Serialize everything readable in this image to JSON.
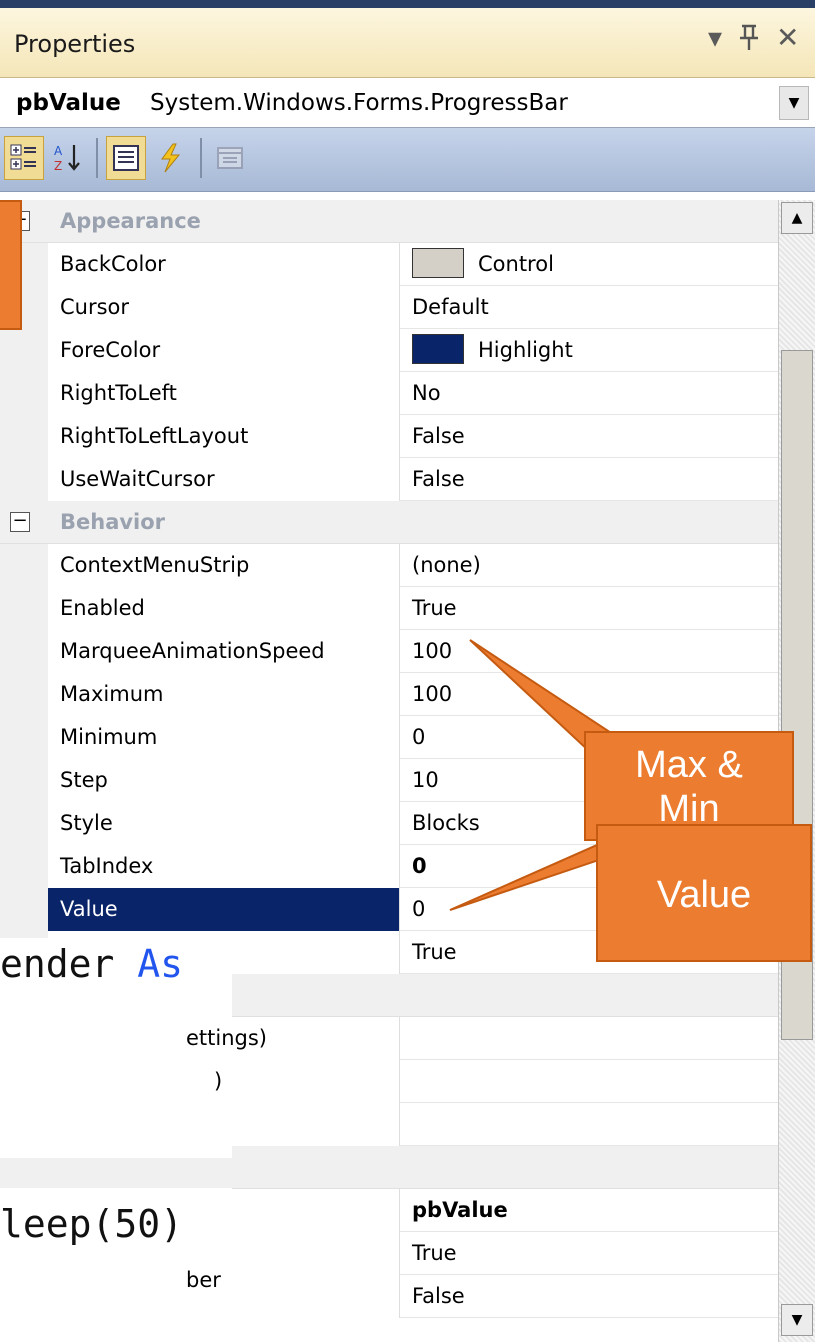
{
  "window": {
    "title": "Properties",
    "controls": {
      "dropdown": "▾",
      "pin": "📌",
      "close": "✕"
    }
  },
  "object_selector": {
    "name": "pbValue",
    "type": "System.Windows.Forms.ProgressBar"
  },
  "toolbar": {
    "buttons": [
      "categorized-icon",
      "alphabetical-icon",
      "properties-icon",
      "events-icon",
      "property-pages-icon"
    ]
  },
  "categories": [
    {
      "label": "Appearance",
      "rows": [
        {
          "name": "BackColor",
          "value": "Control",
          "swatch": "#d4d0c8"
        },
        {
          "name": "Cursor",
          "value": "Default"
        },
        {
          "name": "ForeColor",
          "value": "Highlight",
          "swatch": "#0a246a"
        },
        {
          "name": "RightToLeft",
          "value": "No"
        },
        {
          "name": "RightToLeftLayout",
          "value": "False"
        },
        {
          "name": "UseWaitCursor",
          "value": "False"
        }
      ]
    },
    {
      "label": "Behavior",
      "rows": [
        {
          "name": "ContextMenuStrip",
          "value": "(none)"
        },
        {
          "name": "Enabled",
          "value": "True"
        },
        {
          "name": "MarqueeAnimationSpeed",
          "value": "100"
        },
        {
          "name": "Maximum",
          "value": "100"
        },
        {
          "name": "Minimum",
          "value": "0"
        },
        {
          "name": "Step",
          "value": "10"
        },
        {
          "name": "Style",
          "value": "Blocks"
        },
        {
          "name": "TabIndex",
          "value": "0",
          "bold": true
        },
        {
          "name": "Value",
          "value": "0",
          "selected": true
        },
        {
          "name": "",
          "value": "True"
        }
      ]
    }
  ],
  "lower_rows": [
    {
      "name_fragment": "ettings)",
      "value": ""
    },
    {
      "name_fragment": ")",
      "value": ""
    },
    {
      "name_fragment": "",
      "value": ""
    },
    {
      "name_fragment": "",
      "value": "pbValue",
      "bold": true
    },
    {
      "name_fragment": "ber",
      "value": "True"
    },
    {
      "name_fragment": "",
      "value": "False"
    }
  ],
  "code_overlay": {
    "line1_text": "ender ",
    "line1_kw": "As",
    "line2_text": "leep(50)"
  },
  "callouts": {
    "maxmin": "Max & Min",
    "value": "Value"
  },
  "colors": {
    "callout": "#ec7c30",
    "selection": "#0a246a"
  }
}
